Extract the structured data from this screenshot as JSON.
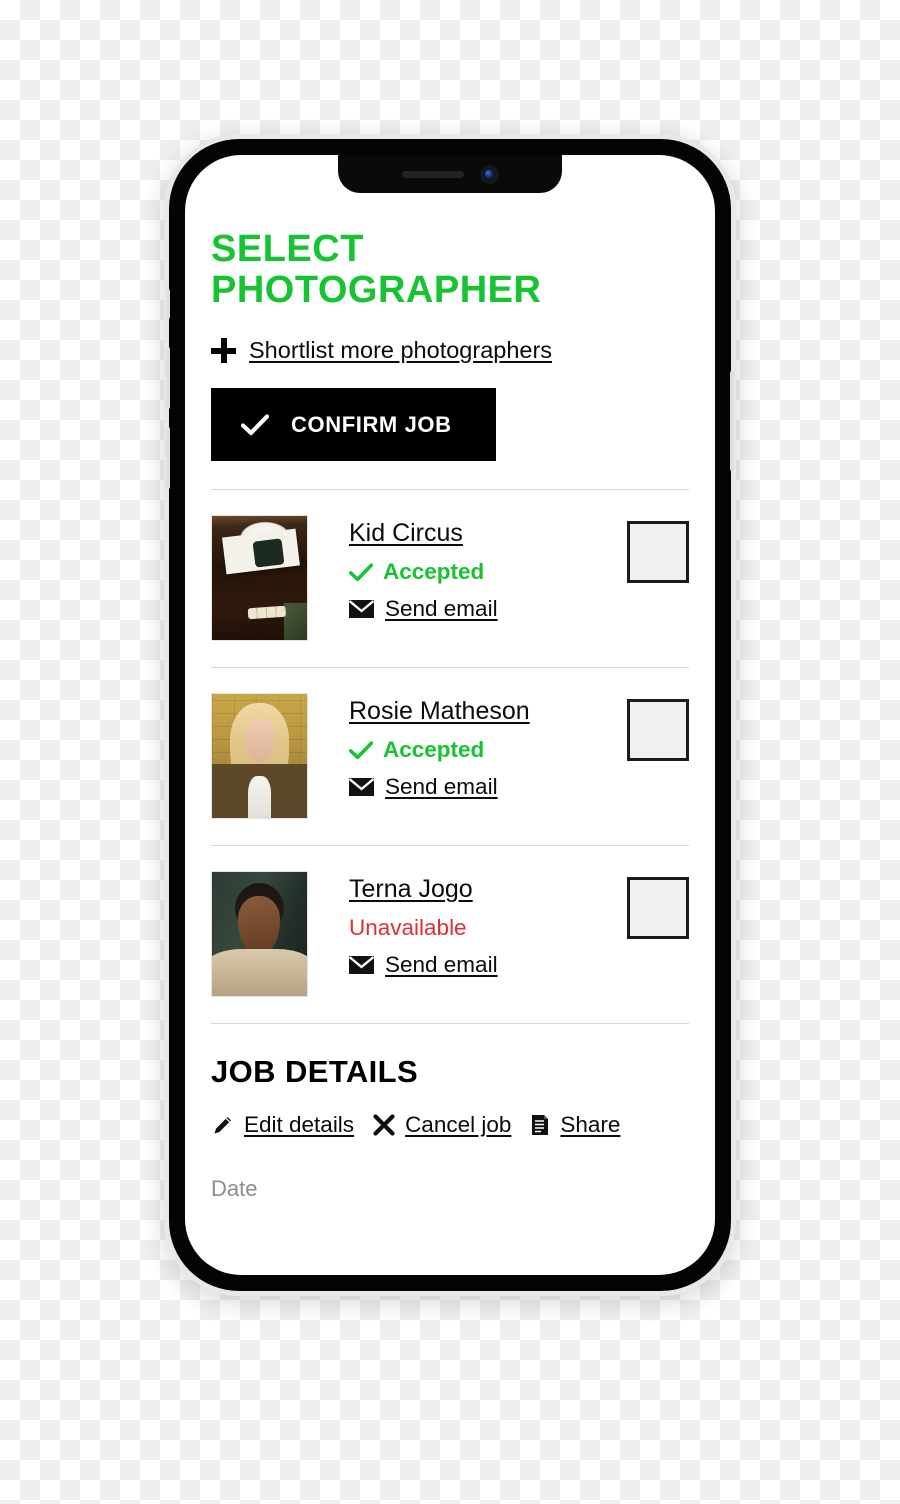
{
  "header": {
    "title": "SELECT PHOTOGRAPHER"
  },
  "shortlist": {
    "icon": "plus-icon",
    "label": "Shortlist more photographers"
  },
  "confirm": {
    "icon": "check-icon",
    "label": "CONFIRM JOB"
  },
  "colors": {
    "accent_green": "#16C432",
    "status_unavailable_red": "#E03030",
    "button_black": "#000000",
    "divider_grey": "#D7D7D7",
    "checkbox_fill": "#F0F0F0",
    "date_label_grey": "#8D8D8D"
  },
  "photographers": [
    {
      "name": "Kid Circus",
      "status": "Accepted",
      "status_type": "accepted",
      "status_icon": "check-icon",
      "email_icon": "envelope-icon",
      "email_label": "Send email",
      "checkbox_checked": false
    },
    {
      "name": "Rosie Matheson",
      "status": "Accepted",
      "status_type": "accepted",
      "status_icon": "check-icon",
      "email_icon": "envelope-icon",
      "email_label": "Send email",
      "checkbox_checked": false
    },
    {
      "name": "Terna Jogo",
      "status": "Unavailable",
      "status_type": "unavailable",
      "status_icon": "none",
      "email_icon": "envelope-icon",
      "email_label": "Send email",
      "checkbox_checked": false
    }
  ],
  "job_details": {
    "heading": "JOB DETAILS",
    "actions": [
      {
        "icon": "pencil-icon",
        "label": "Edit details"
      },
      {
        "icon": "close-x-icon",
        "label": "Cancel job"
      },
      {
        "icon": "copy-icon",
        "label": "Share"
      }
    ],
    "date_field_label": "Date"
  }
}
